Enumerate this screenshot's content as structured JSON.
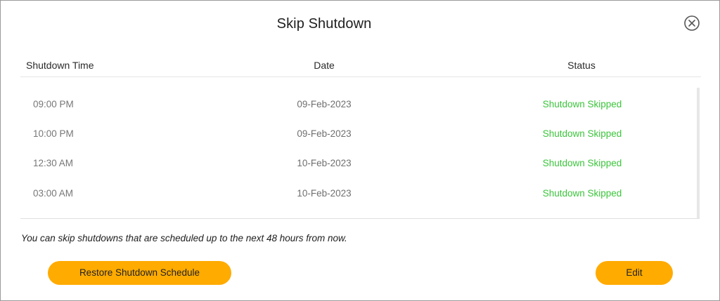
{
  "dialog": {
    "title": "Skip Shutdown",
    "close_icon": "close-circle-icon"
  },
  "table": {
    "columns": [
      "Shutdown Time",
      "Date",
      "Status"
    ],
    "rows": [
      {
        "time": "09:00 PM",
        "date": "09-Feb-2023",
        "status": "Shutdown Skipped"
      },
      {
        "time": "10:00 PM",
        "date": "09-Feb-2023",
        "status": "Shutdown Skipped"
      },
      {
        "time": "12:30 AM",
        "date": "10-Feb-2023",
        "status": "Shutdown Skipped"
      },
      {
        "time": "03:00 AM",
        "date": "10-Feb-2023",
        "status": "Shutdown Skipped"
      }
    ]
  },
  "note": "You can skip shutdowns that are scheduled up to the next 48 hours from now.",
  "buttons": {
    "restore_label": "Restore Shutdown Schedule",
    "edit_label": "Edit"
  },
  "colors": {
    "accent": "#ffab00",
    "status_skipped": "#3cc43c"
  }
}
